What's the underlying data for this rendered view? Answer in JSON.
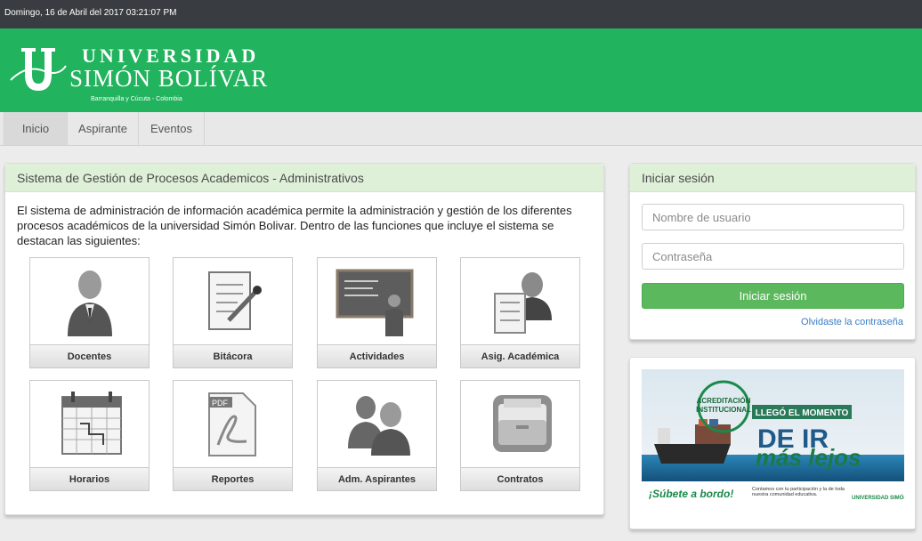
{
  "topbar": {
    "datetime": "Domingo, 16 de Abril del 2017 03:21:07 PM"
  },
  "logo": {
    "line1": "UNIVERSIDAD",
    "line2": "SIMÓN BOLÍVAR",
    "subtitle": "Barranquilla y Cúcuta - Colombia",
    "signature": "Simón Bolívar"
  },
  "nav": {
    "items": [
      "Inicio",
      "Aspirante",
      "Eventos"
    ],
    "active": "Inicio"
  },
  "main": {
    "title": "Sistema de Gestión de Procesos Academicos - Administrativos",
    "intro": "El sistema de administración de información académica permite la administración y gestión de los diferentes procesos académicos de la universidad Simón Bolivar. Dentro de las funciones que incluye el sistema se destacan las siguientes:",
    "tiles": [
      {
        "label": "Docentes",
        "icon": "teacher-icon"
      },
      {
        "label": "Bitácora",
        "icon": "log-document-icon"
      },
      {
        "label": "Actividades",
        "icon": "presentation-board-icon"
      },
      {
        "label": "Asig. Académica",
        "icon": "assignment-checklist-icon"
      },
      {
        "label": "Horarios",
        "icon": "calendar-icon"
      },
      {
        "label": "Reportes",
        "icon": "pdf-report-icon"
      },
      {
        "label": "Adm. Aspirantes",
        "icon": "applicants-icon"
      },
      {
        "label": "Contratos",
        "icon": "folder-icon"
      }
    ]
  },
  "login": {
    "title": "Iniciar sesión",
    "username_placeholder": "Nombre de usuario",
    "password_placeholder": "Contraseña",
    "submit_label": "Iniciar sesión",
    "forgot_label": "Olvidaste la contraseña"
  },
  "ad": {
    "badge_line1": "ACREDITACIÓN",
    "badge_line2": "INSTITUCIONAL",
    "headline": "LLEGÓ EL MOMENTO",
    "slogan1": "DE IR",
    "slogan2": "más lejos",
    "cta": "¡Súbete a bordo!",
    "note": "Contamos con tu participación y la de toda nuestra comunidad educativa.",
    "brand": "UNIVERSIDAD SIMÓN BOLÍVAR"
  },
  "colors": {
    "banner": "#21b35d",
    "topbar": "#393d41",
    "panel_header": "#dff0d8",
    "button": "#5cb85c",
    "link": "#3b7dc4"
  }
}
